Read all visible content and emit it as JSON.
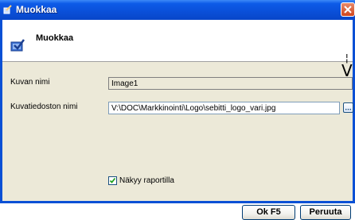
{
  "window": {
    "title": "Muokkaa"
  },
  "header": {
    "title": "Muokkaa",
    "marker": "¦\nV"
  },
  "form": {
    "image_name_label": "Kuvan nimi",
    "image_name_value": "Image1",
    "image_file_label": "Kuvatiedoston nimi",
    "image_file_value": "V:\\DOC\\Markkinointi\\Logo\\sebitti_logo_vari.jpg",
    "visible_in_report_label": "Näkyy raportilla",
    "visible_in_report_checked": true
  },
  "buttons": {
    "ok": "Ok F5",
    "cancel": "Peruuta"
  },
  "colors": {
    "title_bar": "#0a50d5",
    "close": "#d0451c",
    "face": "#ece9d8"
  }
}
